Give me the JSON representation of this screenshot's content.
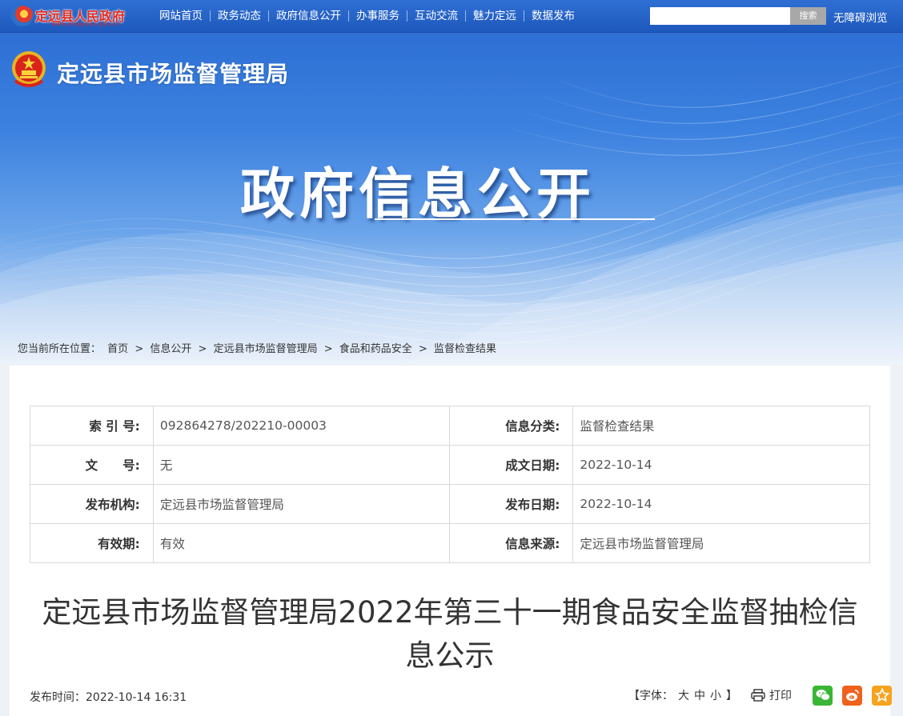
{
  "site": {
    "logo_text": "定远县人民政府",
    "logo_url": "www.dingyuan.gov.cn",
    "nav": [
      "网站首页",
      "政务动态",
      "政府信息公开",
      "办事服务",
      "互动交流",
      "魅力定远",
      "数据发布"
    ],
    "search_value": "",
    "search_button": "搜索",
    "accessibility": "无障碍浏览"
  },
  "banner": {
    "department": "定远县市场监督管理局",
    "title": "政府信息公开"
  },
  "breadcrumb": {
    "prefix": "您当前所在位置：",
    "items": [
      "首页",
      "信息公开",
      "定远县市场监督管理局",
      "食品和药品安全",
      "监督检查结果"
    ],
    "separator": ">"
  },
  "meta": {
    "rows": [
      {
        "k1": "索 引 号:",
        "v1": "092864278/202210-00003",
        "k2": "信息分类:",
        "v2": "监督检查结果"
      },
      {
        "k1": "文　　号:",
        "v1": "无",
        "k2": "成文日期:",
        "v2": "2022-10-14"
      },
      {
        "k1": "发布机构:",
        "v1": "定远县市场监督管理局",
        "k2": "发布日期:",
        "v2": "2022-10-14"
      },
      {
        "k1": "有效期:",
        "v1": "有效",
        "k2": "信息来源:",
        "v2": "定远县市场监督管理局"
      }
    ]
  },
  "article": {
    "title": "定远县市场监督管理局2022年第三十一期食品安全监督抽检信息公示",
    "publish_time": "发布时间：2022-10-14 16:31",
    "font_label_open": "【字体：",
    "font_large": "大",
    "font_medium": "中",
    "font_small": "小",
    "font_label_close": "】",
    "print": "打印"
  },
  "colors": {
    "nav_bg": "#1e59bd",
    "wechat": "#39b636",
    "weibo": "#f0621c",
    "favorite": "#f6a31f"
  },
  "icons": [
    "emblem-icon",
    "print-icon",
    "wechat-icon",
    "weibo-icon",
    "star-icon"
  ]
}
